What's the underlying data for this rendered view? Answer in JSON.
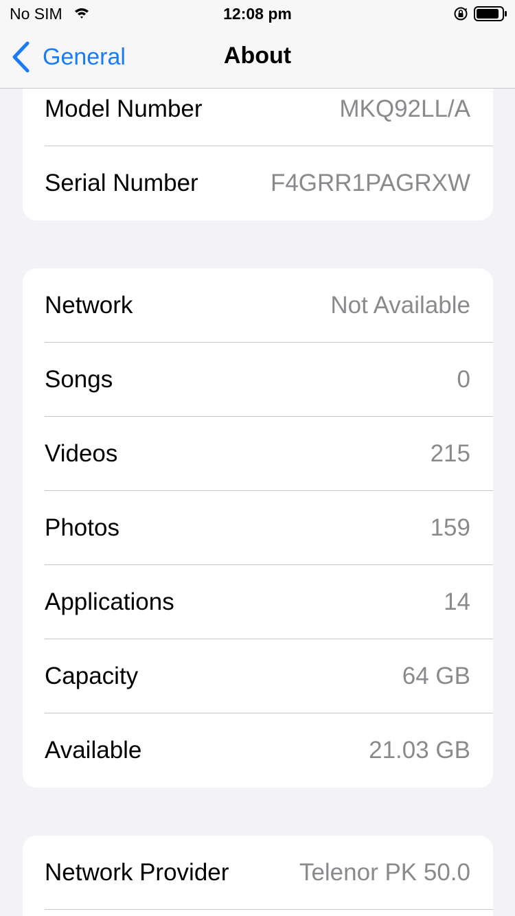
{
  "status_bar": {
    "carrier": "No SIM",
    "time": "12:08 pm",
    "icons": [
      "wifi-icon",
      "orientation-lock-icon",
      "battery-icon"
    ]
  },
  "nav": {
    "back_label": "General",
    "title": "About"
  },
  "groups": [
    {
      "rows": [
        {
          "label": "Model Number",
          "value": "MKQ92LL/A"
        },
        {
          "label": "Serial Number",
          "value": "F4GRR1PAGRXW"
        }
      ]
    },
    {
      "rows": [
        {
          "label": "Network",
          "value": "Not Available"
        },
        {
          "label": "Songs",
          "value": "0"
        },
        {
          "label": "Videos",
          "value": "215"
        },
        {
          "label": "Photos",
          "value": "159"
        },
        {
          "label": "Applications",
          "value": "14"
        },
        {
          "label": "Capacity",
          "value": "64 GB"
        },
        {
          "label": "Available",
          "value": "21.03 GB"
        }
      ]
    },
    {
      "rows": [
        {
          "label": "Network Provider",
          "value": "Telenor PK 50.0"
        }
      ]
    }
  ],
  "colors": {
    "accent": "#1a7cf5",
    "background": "#f2f2f7",
    "secondary_text": "#8a8a8e",
    "separator": "#c8c8cc"
  }
}
